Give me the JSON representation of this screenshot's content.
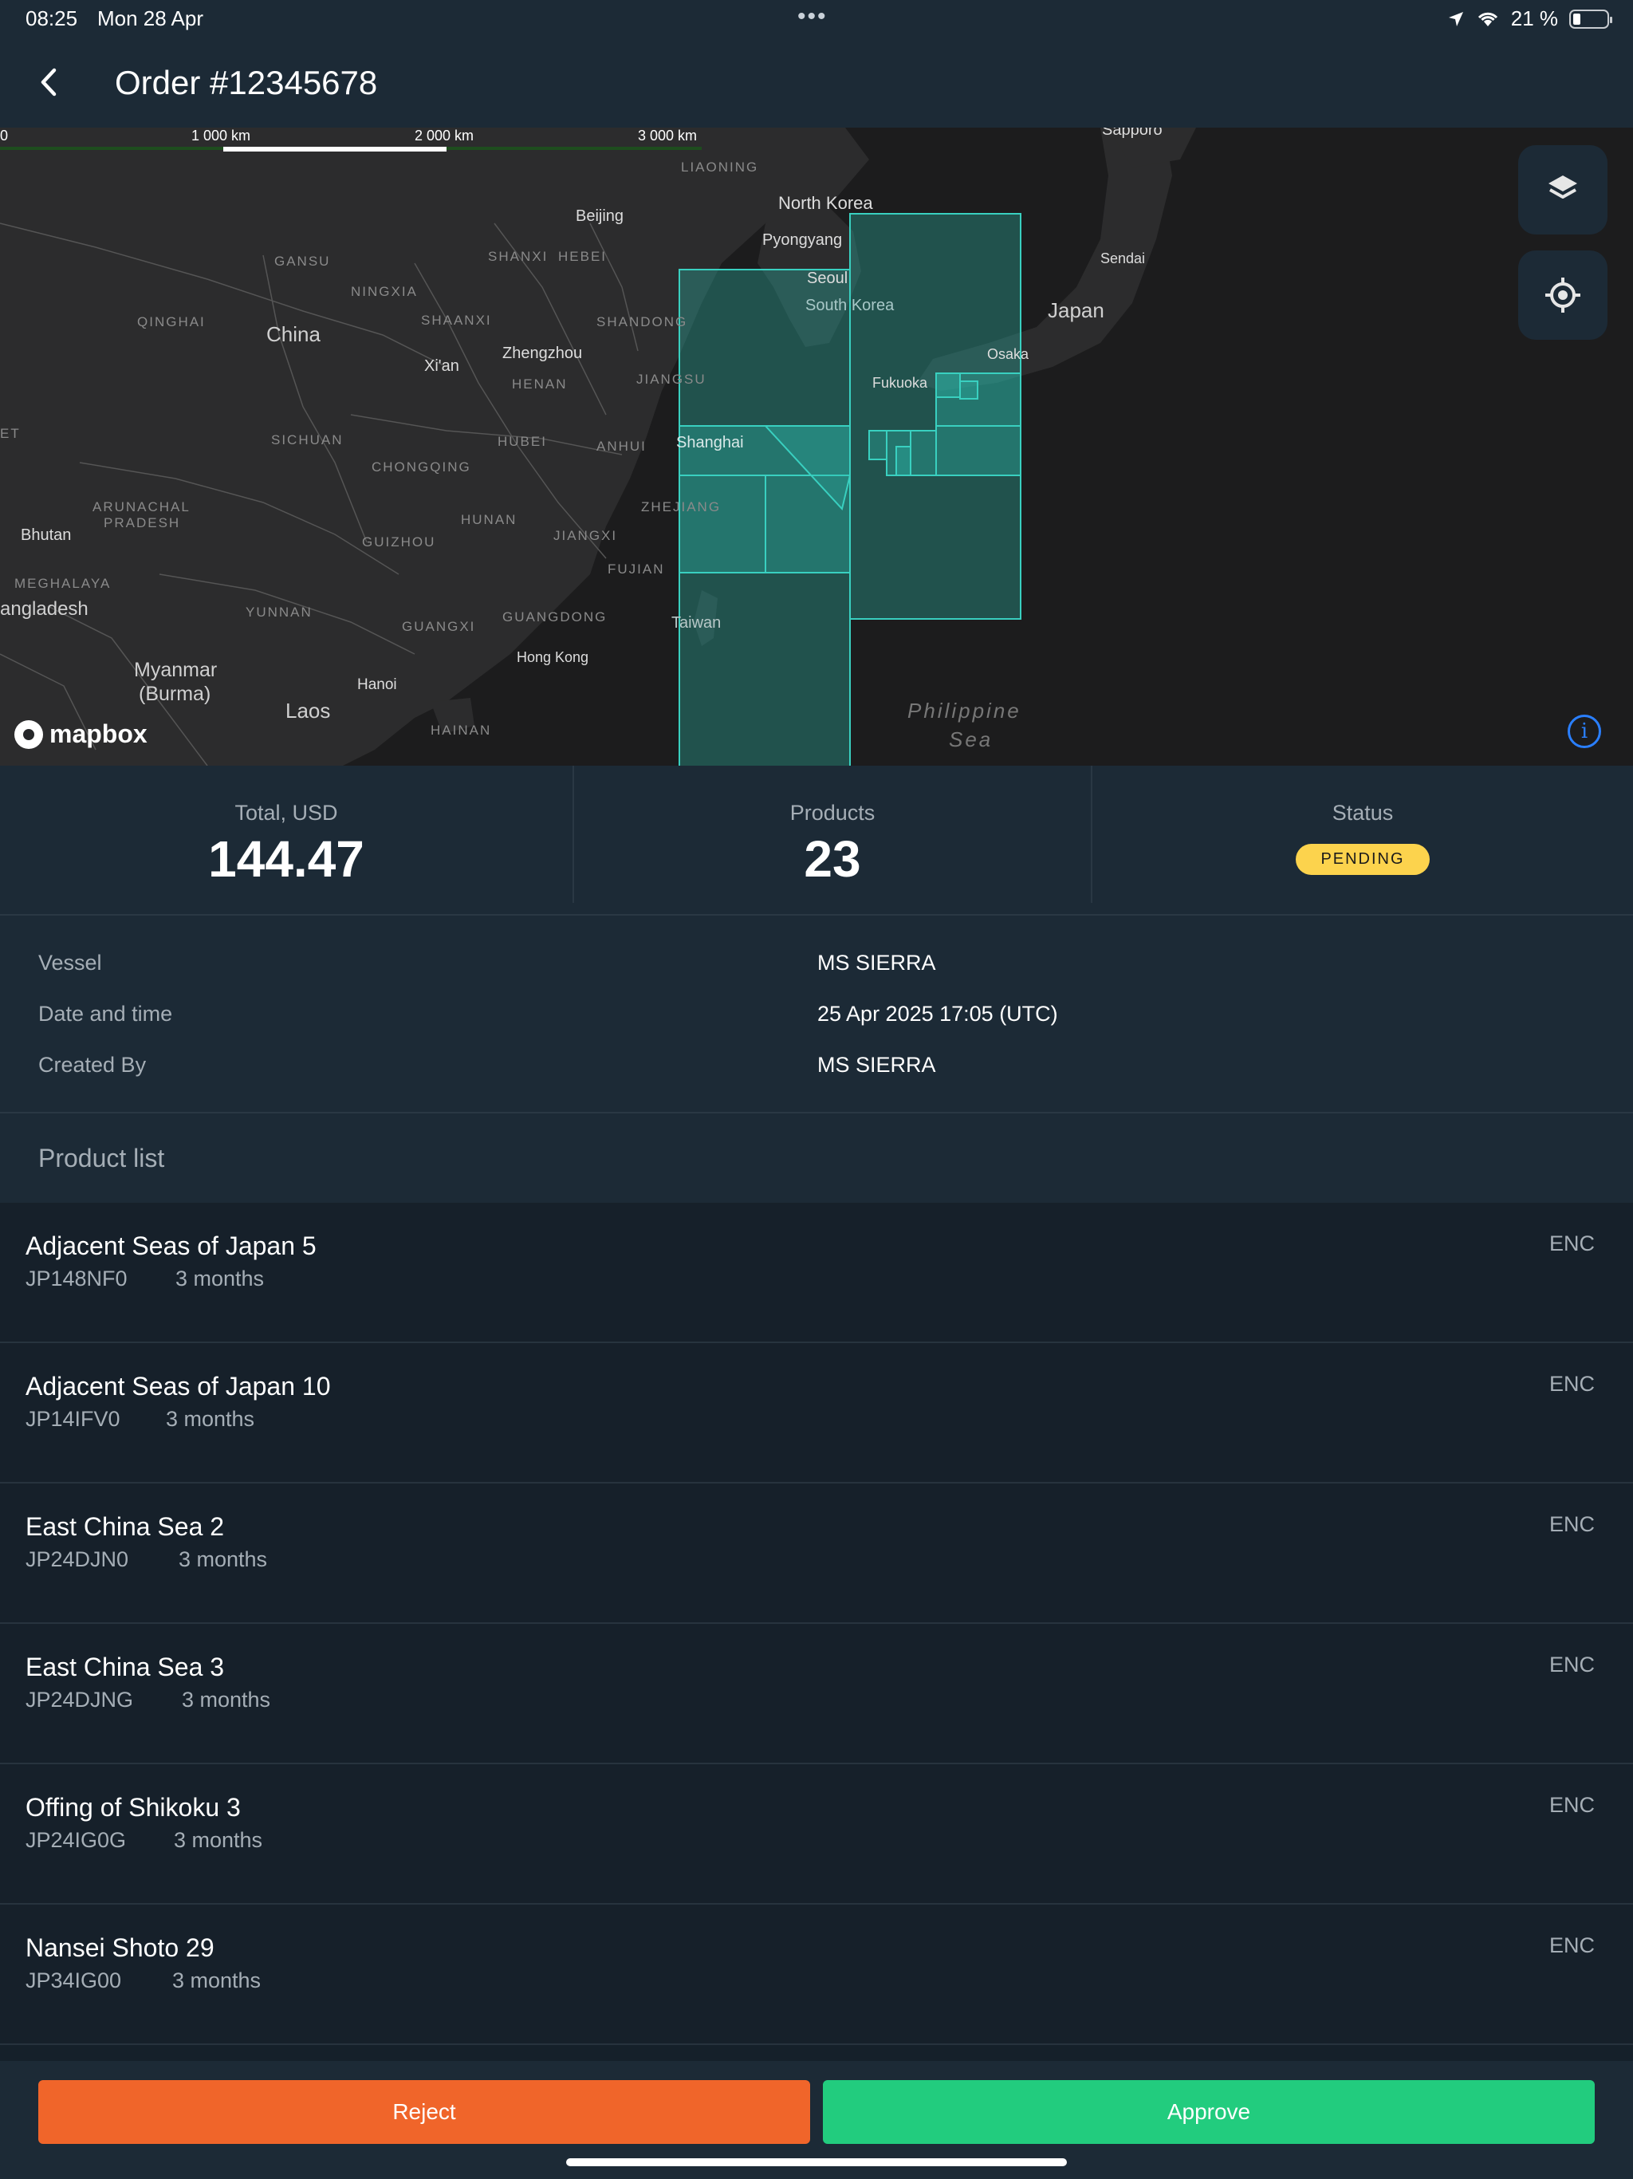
{
  "status_bar": {
    "time": "08:25",
    "date": "Mon 28 Apr",
    "battery": "21 %",
    "battery_level": 0.21
  },
  "header": {
    "title": "Order #12345678"
  },
  "map": {
    "scale": [
      "0",
      "1 000 km",
      "2 000 km",
      "3 000 km"
    ],
    "labels": {
      "sapporo": "Sapporo",
      "liaoning": "LIAONING",
      "north_korea": "North Korea",
      "beijing": "Beijing",
      "pyongyang": "Pyongyang",
      "seoul": "Seoul",
      "south_korea": "South Korea",
      "gansu": "GANSU",
      "shanxi": "SHANXI",
      "hebei": "HEBEI",
      "ningxia": "NINGXIA",
      "qinghai": "QINGHAI",
      "china": "China",
      "shaanxi": "SHAANXI",
      "shandong": "SHANDONG",
      "xian": "Xi'an",
      "zhengzhou": "Zhengzhou",
      "henan": "HENAN",
      "jiangsu": "JIANGSU",
      "sendai": "Sendai",
      "japan": "Japan",
      "osaka": "Osaka",
      "fukuoka": "Fukuoka",
      "et": "ET",
      "sichuan": "SICHUAN",
      "hubei": "HUBEI",
      "anhui": "ANHUI",
      "shanghai": "Shanghai",
      "chongqing": "CHONGQING",
      "arunachal": "ARUNACHAL",
      "pradesh": "PRADESH",
      "hunan": "HUNAN",
      "zhejiang": "ZHEJIANG",
      "bhutan": "Bhutan",
      "jiangxi": "JIANGXI",
      "guizhou": "GUIZHOU",
      "meghalaya": "MEGHALAYA",
      "fujian": "FUJIAN",
      "bangladesh": "angladesh",
      "yunnan": "YUNNAN",
      "guangxi": "GUANGXI",
      "guangdong": "GUANGDONG",
      "taiwan": "Taiwan",
      "hong_kong": "Hong Kong",
      "myanmar": "Myanmar",
      "burma": "(Burma)",
      "hanoi": "Hanoi",
      "laos": "Laos",
      "hainan": "HAINAN",
      "philippine": "Philippine",
      "sea": "Sea"
    },
    "attribution": "mapbox",
    "overlay_color": "#2bb8aa",
    "layers_icon": "layers-icon",
    "locate_icon": "locate-icon",
    "info_icon": "info-icon"
  },
  "summary": {
    "total_label": "Total, USD",
    "total_value": "144.47",
    "products_label": "Products",
    "products_value": "23",
    "status_label": "Status",
    "status_value": "PENDING"
  },
  "details": {
    "vessel_label": "Vessel",
    "vessel_value": "MS SIERRA",
    "datetime_label": "Date and time",
    "datetime_value": "25 Apr 2025 17:05 (UTC)",
    "created_by_label": "Created By",
    "created_by_value": "MS SIERRA"
  },
  "product_list": {
    "title": "Product list",
    "items": [
      {
        "name": "Adjacent Seas of Japan 5",
        "code": "JP148NF0",
        "period": "3 months",
        "type": "ENC"
      },
      {
        "name": "Adjacent Seas of Japan 10",
        "code": "JP14IFV0",
        "period": "3 months",
        "type": "ENC"
      },
      {
        "name": "East China Sea 2",
        "code": "JP24DJN0",
        "period": "3 months",
        "type": "ENC"
      },
      {
        "name": "East China Sea 3",
        "code": "JP24DJNG",
        "period": "3 months",
        "type": "ENC"
      },
      {
        "name": "Offing of Shikoku 3",
        "code": "JP24IG0G",
        "period": "3 months",
        "type": "ENC"
      },
      {
        "name": "Nansei Shoto 29",
        "code": "JP34IG00",
        "period": "3 months",
        "type": "ENC"
      }
    ]
  },
  "footer": {
    "reject_label": "Reject",
    "approve_label": "Approve",
    "reject_color": "#f0652a",
    "approve_color": "#22cc7e"
  }
}
